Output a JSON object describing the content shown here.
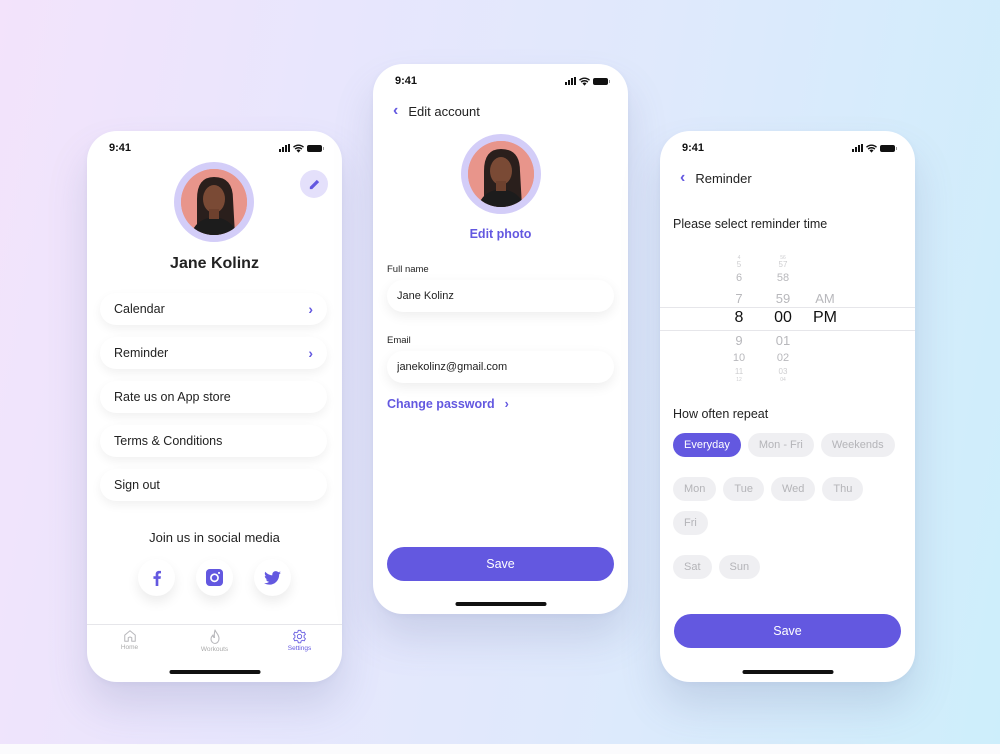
{
  "colors": {
    "accent": "#6358e0",
    "accent_light": "#d3cdf8",
    "chip_bg": "#efeff2"
  },
  "status_bar": {
    "time": "9:41"
  },
  "profile_screen": {
    "name": "Jane Kolinz",
    "edit_icon": "pencil-icon",
    "menu": [
      {
        "label": "Calendar",
        "has_chevron": true
      },
      {
        "label": "Reminder",
        "has_chevron": true
      },
      {
        "label": "Rate us on App store",
        "has_chevron": false
      },
      {
        "label": "Terms & Conditions",
        "has_chevron": false
      },
      {
        "label": "Sign out",
        "has_chevron": false
      }
    ],
    "chevron": "›",
    "social_title": "Join us in social media",
    "socials": [
      "facebook-icon",
      "instagram-icon",
      "twitter-icon"
    ],
    "tabs": [
      {
        "label": "Home",
        "icon": "home-icon",
        "active": false
      },
      {
        "label": "Workouts",
        "icon": "flame-icon",
        "active": false
      },
      {
        "label": "Settings",
        "icon": "gear-icon",
        "active": true
      }
    ]
  },
  "edit_account_screen": {
    "back": "‹",
    "title": "Edit account",
    "edit_photo": "Edit photo",
    "full_name_label": "Full name",
    "full_name_value": "Jane Kolinz",
    "email_label": "Email",
    "email_value": "janekolinz@gmail.com",
    "change_password": "Change password",
    "change_password_chevron": "›",
    "save": "Save"
  },
  "reminder_screen": {
    "back": "‹",
    "title": "Reminder",
    "prompt": "Please select reminder time",
    "picker": {
      "hours": [
        "4",
        "5",
        "6",
        "7",
        "8",
        "9",
        "10",
        "11",
        "12"
      ],
      "minutes": [
        "56",
        "57",
        "58",
        "59",
        "00",
        "01",
        "02",
        "03",
        "04"
      ],
      "periods": [
        "AM",
        "PM"
      ],
      "selected_hour": "8",
      "selected_minute": "00",
      "selected_period": "PM"
    },
    "repeat_title": "How often repeat",
    "chips": [
      {
        "label": "Everyday",
        "active": true
      },
      {
        "label": "Mon - Fri",
        "active": false
      },
      {
        "label": "Weekends",
        "active": false
      },
      {
        "label": "Mon",
        "active": false
      },
      {
        "label": "Tue",
        "active": false
      },
      {
        "label": "Wed",
        "active": false
      },
      {
        "label": "Thu",
        "active": false
      },
      {
        "label": "Fri",
        "active": false
      },
      {
        "label": "Sat",
        "active": false
      },
      {
        "label": "Sun",
        "active": false
      }
    ],
    "save": "Save"
  }
}
